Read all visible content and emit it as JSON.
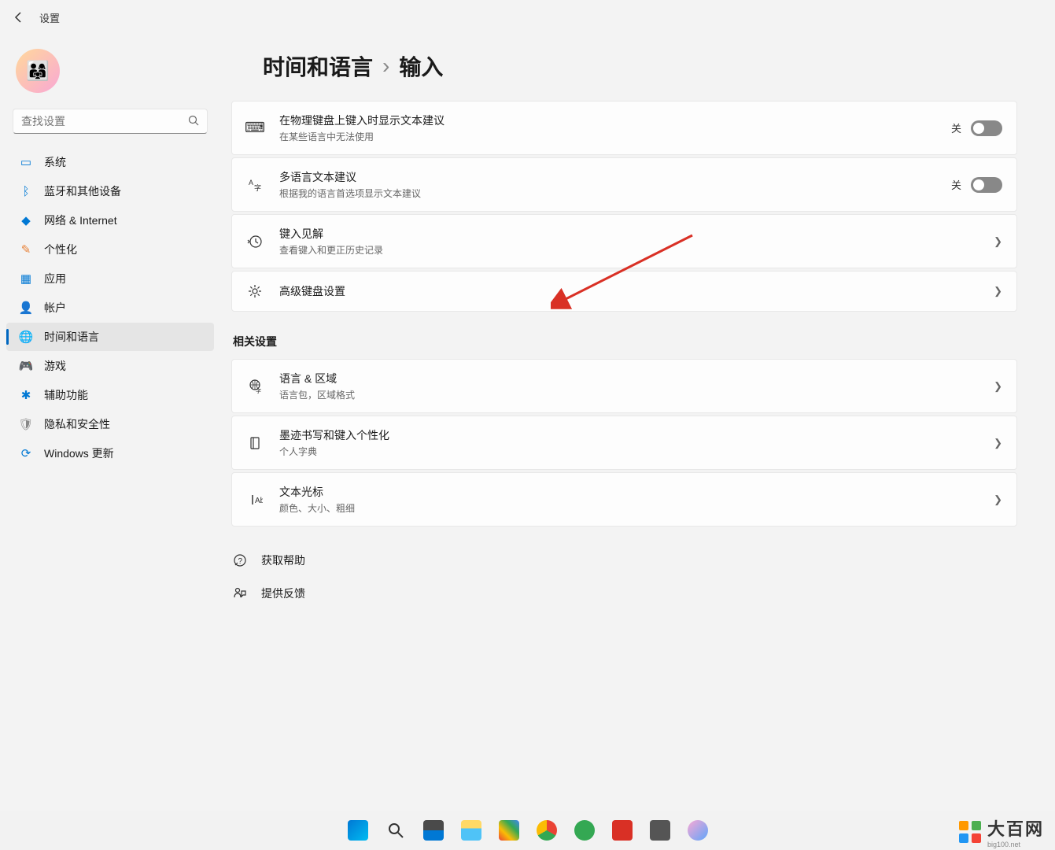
{
  "titlebar": {
    "title": "设置"
  },
  "search": {
    "placeholder": "查找设置"
  },
  "sidebar": {
    "items": [
      {
        "label": "系统",
        "icon": "🖥️",
        "color": "#0078d4"
      },
      {
        "label": "蓝牙和其他设备",
        "icon": "ᛒ",
        "color": "#0078d4"
      },
      {
        "label": "网络 & Internet",
        "icon": "📶",
        "color": "#0078d4"
      },
      {
        "label": "个性化",
        "icon": "🖌️",
        "color": "#8b5cf6"
      },
      {
        "label": "应用",
        "icon": "▦",
        "color": "#0078d4"
      },
      {
        "label": "帐户",
        "icon": "👤",
        "color": "#0078d4"
      },
      {
        "label": "时间和语言",
        "icon": "🌐",
        "color": "#0078d4",
        "active": true
      },
      {
        "label": "游戏",
        "icon": "🎮",
        "color": "#0078d4"
      },
      {
        "label": "辅助功能",
        "icon": "♿",
        "color": "#0078d4"
      },
      {
        "label": "隐私和安全性",
        "icon": "🛡️",
        "color": "#666"
      },
      {
        "label": "Windows 更新",
        "icon": "🔄",
        "color": "#0078d4"
      }
    ]
  },
  "breadcrumb": {
    "parent": "时间和语言",
    "current": "输入"
  },
  "settings": [
    {
      "title": "在物理键盘上键入时显示文本建议",
      "subtitle": "在某些语言中无法使用",
      "control": "toggle",
      "state": "关"
    },
    {
      "title": "多语言文本建议",
      "subtitle": "根据我的语言首选项显示文本建议",
      "control": "toggle",
      "state": "关"
    },
    {
      "title": "键入见解",
      "subtitle": "查看键入和更正历史记录",
      "control": "link"
    },
    {
      "title": "高级键盘设置",
      "control": "link"
    }
  ],
  "related_header": "相关设置",
  "related": [
    {
      "title": "语言 & 区域",
      "subtitle": "语言包，区域格式"
    },
    {
      "title": "墨迹书写和键入个性化",
      "subtitle": "个人字典"
    },
    {
      "title": "文本光标",
      "subtitle": "颜色、大小、粗细"
    }
  ],
  "help_links": [
    {
      "label": "获取帮助"
    },
    {
      "label": "提供反馈"
    }
  ],
  "watermark": {
    "main": "大百网",
    "sub": "big100.net"
  }
}
